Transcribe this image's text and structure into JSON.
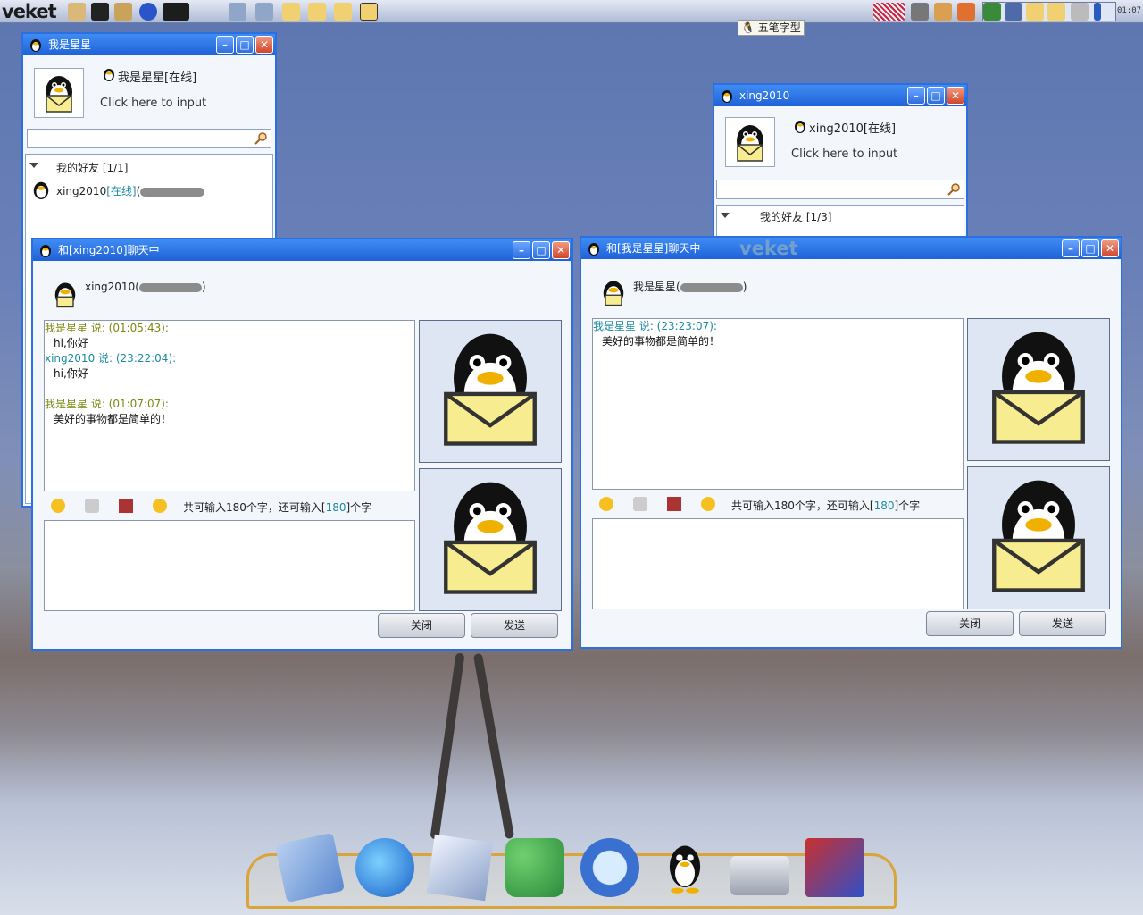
{
  "taskbar": {
    "logo": "veket",
    "clock": "01:07",
    "ime_label": "五笔字型"
  },
  "window_main_left": {
    "title": "我是星星",
    "status_name": "我是星星[在线]",
    "signature_placeholder": "Click here to input",
    "group_label": "我的好友 [1/1]",
    "friend_name": "xing2010",
    "friend_status": "[在线]",
    "friend_open_paren": "("
  },
  "window_main_right": {
    "title": "xing2010",
    "status_name": "xing2010[在线]",
    "signature_placeholder": "Click here to input",
    "group_label": "我的好友 [1/3]"
  },
  "chat_left": {
    "title": "和[xing2010]聊天中",
    "peer_name": "xing2010",
    "peer_open_paren": "(",
    "peer_close_paren": ")",
    "messages": [
      {
        "who": "我是星星 说: (01:05:43):",
        "text": "hi,你好"
      },
      {
        "who": "xing2010 说: (23:22:04):",
        "text": "hi,你好"
      },
      {
        "who": "我是星星 说: (01:07:07):",
        "text": "美好的事物都是简单的！"
      }
    ],
    "counter_prefix": "共可输入180个字，还可输入[",
    "counter_value": "180",
    "counter_suffix": "]个字",
    "close_label": "关闭",
    "send_label": "发送"
  },
  "chat_right": {
    "title": "和[我是星星]聊天中",
    "peer_name": "我是星星",
    "peer_open_paren": "(",
    "peer_close_paren": ")",
    "messages": [
      {
        "who": "我是星星 说: (23:23:07):",
        "text": "美好的事物都是简单的！"
      }
    ],
    "counter_prefix": "共可输入180个字，还可输入[",
    "counter_value": "180",
    "counter_suffix": "]个字",
    "close_label": "关闭",
    "send_label": "发送",
    "watermark": "veket"
  },
  "dock": {
    "icons": [
      "music-icon",
      "browser-icon",
      "text-editor-icon",
      "users-network-icon",
      "search-icon",
      "qq-penguin-icon",
      "network-drive-icon",
      "camera-icon"
    ]
  }
}
